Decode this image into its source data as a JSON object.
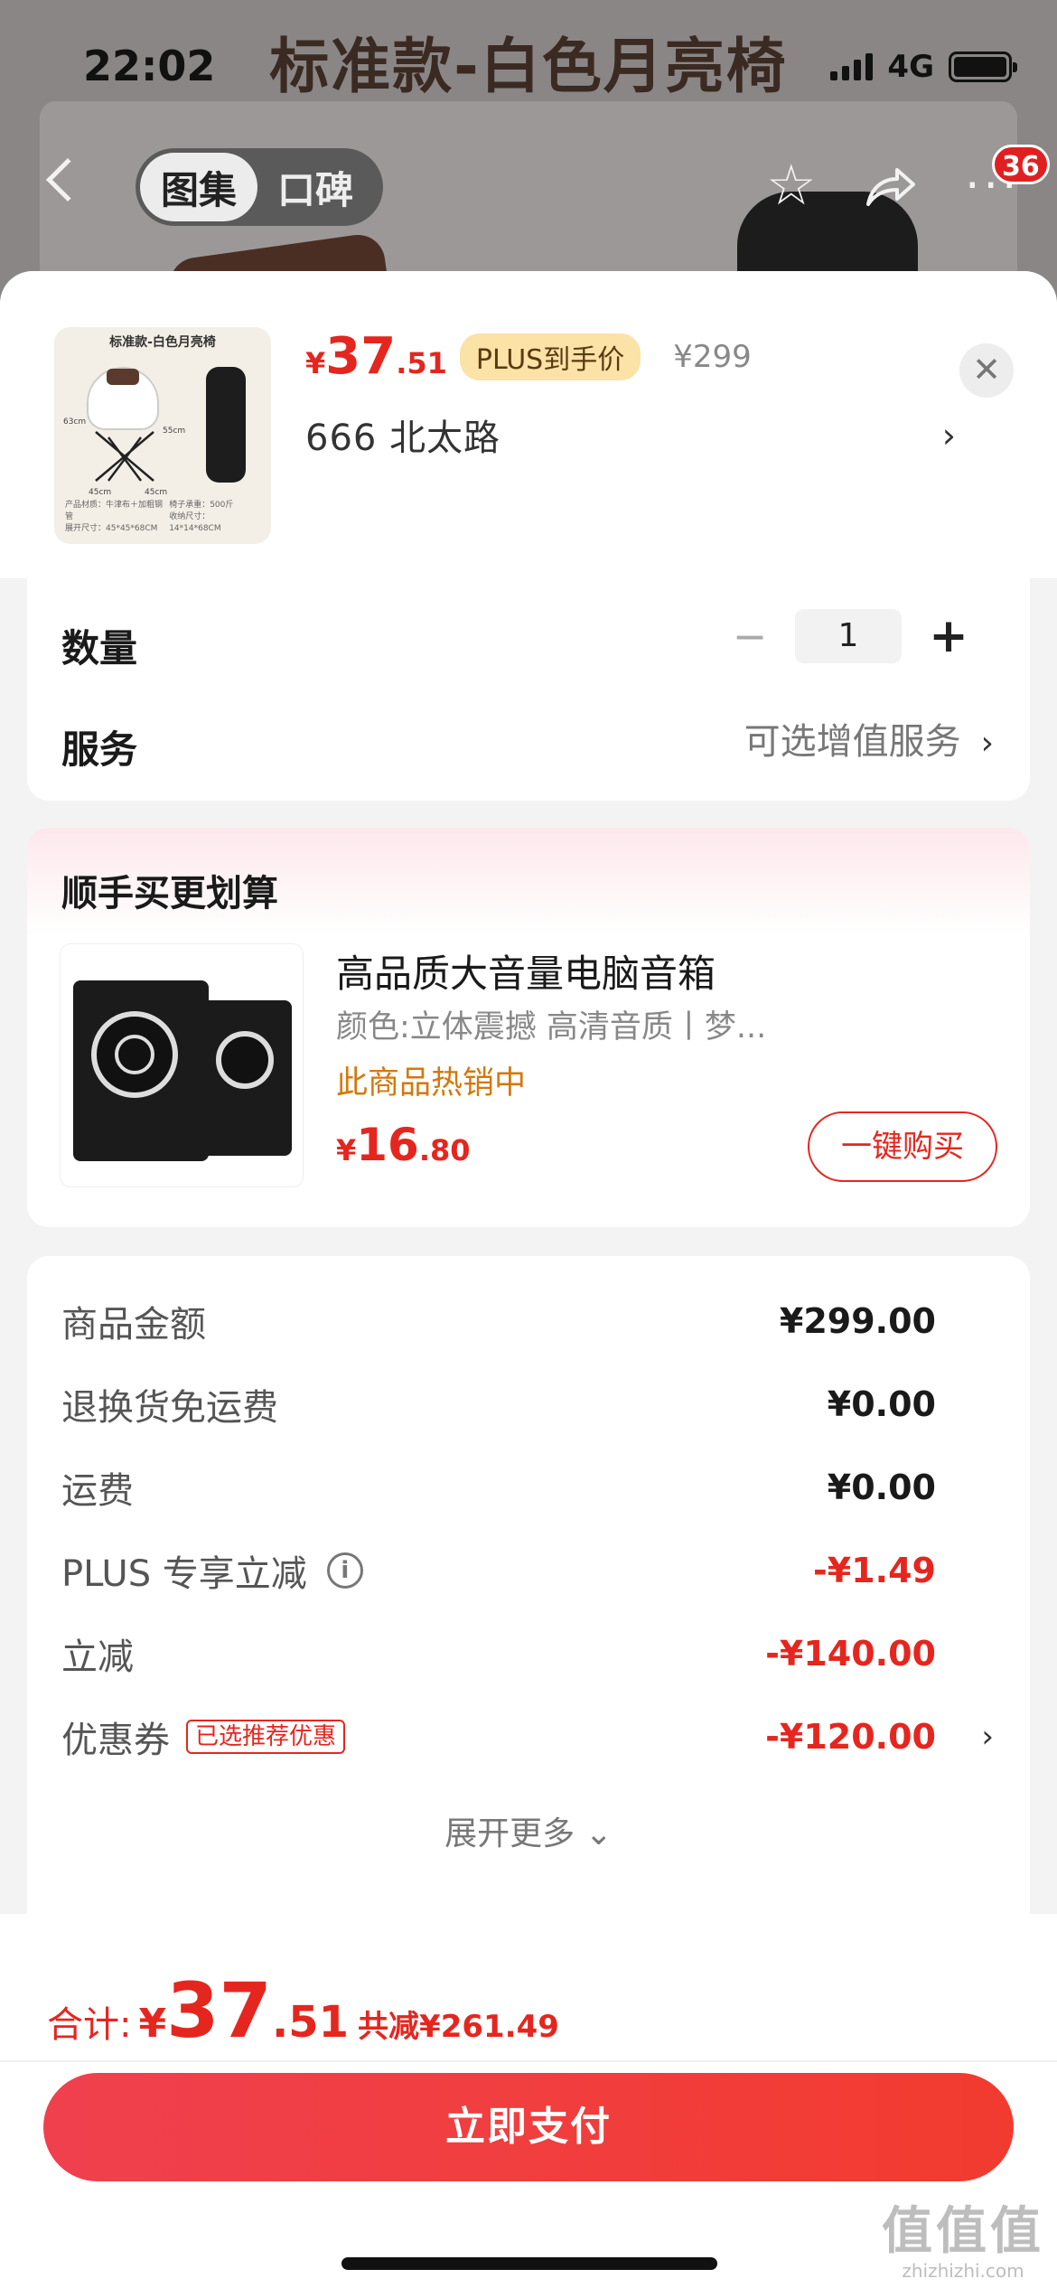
{
  "background": {
    "page_title": "标准款-白色月亮椅",
    "status": {
      "time": "22:02",
      "network": "4G"
    },
    "nav": {
      "tabs": [
        {
          "label": "图集",
          "active": true
        },
        {
          "label": "口碑",
          "active": false
        }
      ],
      "message_badge": "36"
    }
  },
  "sheet": {
    "thumbnail": {
      "title": "标准款-白色月亮椅",
      "dims": {
        "height_a": "63cm",
        "height_b": "55cm",
        "width_a": "45cm",
        "width_b": "45cm"
      },
      "footer_left": "产品材质：牛津布＋加粗钢管\n展开尺寸：45*45*68CM",
      "footer_right": "椅子承重：500斤\n收纳尺寸：14*14*68CM"
    },
    "price": {
      "symbol": "¥",
      "integer": "37",
      "decimal": ".51"
    },
    "plus_tag": "PLUS到手价",
    "original_price": "¥299",
    "address": "666  北太路",
    "quantity": {
      "label": "数量",
      "minus": "−",
      "value": "1",
      "plus": "+"
    },
    "service": {
      "label": "服务",
      "value": "可选增值服务"
    },
    "recommend": {
      "title": "顺手买更划算",
      "product_name": "高品质大音量电脑音箱",
      "attributes": "颜色:立体震撼 高清音质丨梦...",
      "hot_text": "此商品热销中",
      "price": {
        "symbol": "¥",
        "integer": "16",
        "decimal": ".80"
      },
      "buy_button": "一键购买"
    },
    "summary": {
      "rows": [
        {
          "label": "商品金额",
          "value": "¥299.00",
          "red": false
        },
        {
          "label": "退换货免运费",
          "value": "¥0.00",
          "red": false
        },
        {
          "label": "运费",
          "value": "¥0.00",
          "red": false
        },
        {
          "label": "PLUS 专享立减",
          "value": "-¥1.49",
          "red": true
        },
        {
          "label": "立减",
          "value": "-¥140.00",
          "red": true
        },
        {
          "label": "优惠券",
          "value": "-¥120.00",
          "red": true
        }
      ],
      "coupon_tag": "已选推荐优惠",
      "expand_more": "展开更多"
    },
    "footer": {
      "total_label": "合计:",
      "total": {
        "symbol": "¥",
        "integer": "37",
        "decimal": ".51"
      },
      "total_saved": "共减¥261.49",
      "pay_button": "立即支付"
    }
  },
  "watermark": {
    "main": "值值值",
    "sub": "zhizhizhi.com"
  },
  "colors": {
    "accent_red": "#e5261f",
    "plus_tag_bg": "#fbe2a6",
    "hot_orange": "#d4780c"
  }
}
